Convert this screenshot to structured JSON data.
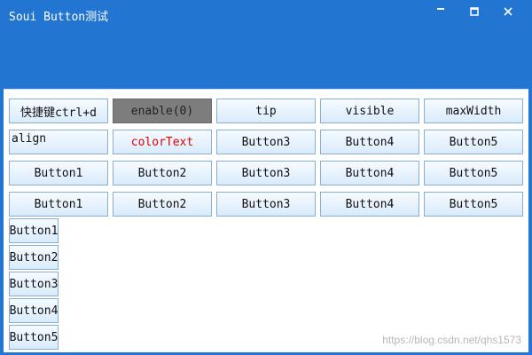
{
  "window": {
    "title": "Soui Button测试",
    "min_icon": "minimize-icon",
    "max_icon": "maximize-icon",
    "close_icon": "close-icon"
  },
  "rows": [
    [
      "快捷键ctrl+d",
      "enable(0)",
      "tip",
      "visible",
      "maxWidth"
    ],
    [
      "align",
      "colorText",
      "Button3",
      "Button4",
      "Button5"
    ],
    [
      "Button1",
      "Button2",
      "Button3",
      "Button4",
      "Button5"
    ],
    [
      "Button1",
      "Button2",
      "Button3",
      "Button4",
      "Button5"
    ]
  ],
  "vertical_buttons": [
    "Button1",
    "Button2",
    "Button3",
    "Button4",
    "Button5"
  ],
  "watermark": "https://blog.csdn.net/qhs1573",
  "colors": {
    "titlebar": "#2275d0",
    "disabled": "#7d7d7d",
    "red_text": "#e00000"
  }
}
